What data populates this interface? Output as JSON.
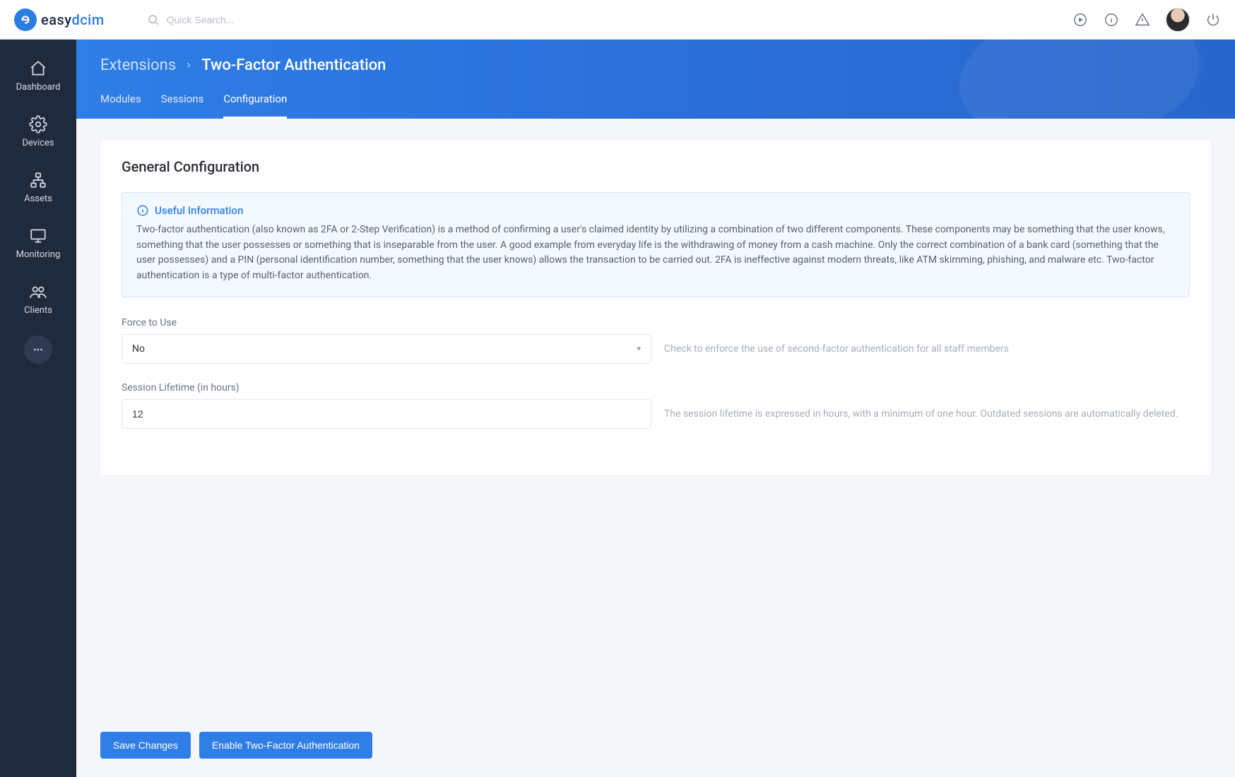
{
  "brand": {
    "easy": "easy",
    "dcim": "dcim"
  },
  "search": {
    "placeholder": "Quick Search..."
  },
  "sidebar": {
    "items": [
      {
        "label": "Dashboard"
      },
      {
        "label": "Devices"
      },
      {
        "label": "Assets"
      },
      {
        "label": "Monitoring"
      },
      {
        "label": "Clients"
      }
    ]
  },
  "breadcrumb": {
    "root": "Extensions",
    "leaf": "Two-Factor Authentication"
  },
  "tabs": [
    {
      "label": "Modules",
      "active": false
    },
    {
      "label": "Sessions",
      "active": false
    },
    {
      "label": "Configuration",
      "active": true
    }
  ],
  "section": {
    "title": "General Configuration",
    "info_title": "Useful Information",
    "info_text": "Two-factor authentication (also known as 2FA or 2-Step Verification) is a method of confirming a user's claimed identity by utilizing a combination of two different components. These components may be something that the user knows, something that the user possesses or something that is inseparable from the user. A good example from everyday life is the withdrawing of money from a cash machine. Only the correct combination of a bank card (something that the user possesses) and a PIN (personal identification number, something that the user knows) allows the transaction to be carried out. 2FA is ineffective against modern threats, like ATM skimming, phishing, and malware etc. Two-factor authentication is a type of multi-factor authentication."
  },
  "form": {
    "force_label": "Force to Use",
    "force_value": "No",
    "force_hint": "Check to enforce the use of second-factor authentication for all staff members",
    "lifetime_label": "Session Lifetime (in hours)",
    "lifetime_value": "12",
    "lifetime_hint": "The session lifetime is expressed in hours, with a minimum of one hour. Outdated sessions are automatically deleted."
  },
  "actions": {
    "save": "Save Changes",
    "enable": "Enable Two-Factor Authentication"
  }
}
